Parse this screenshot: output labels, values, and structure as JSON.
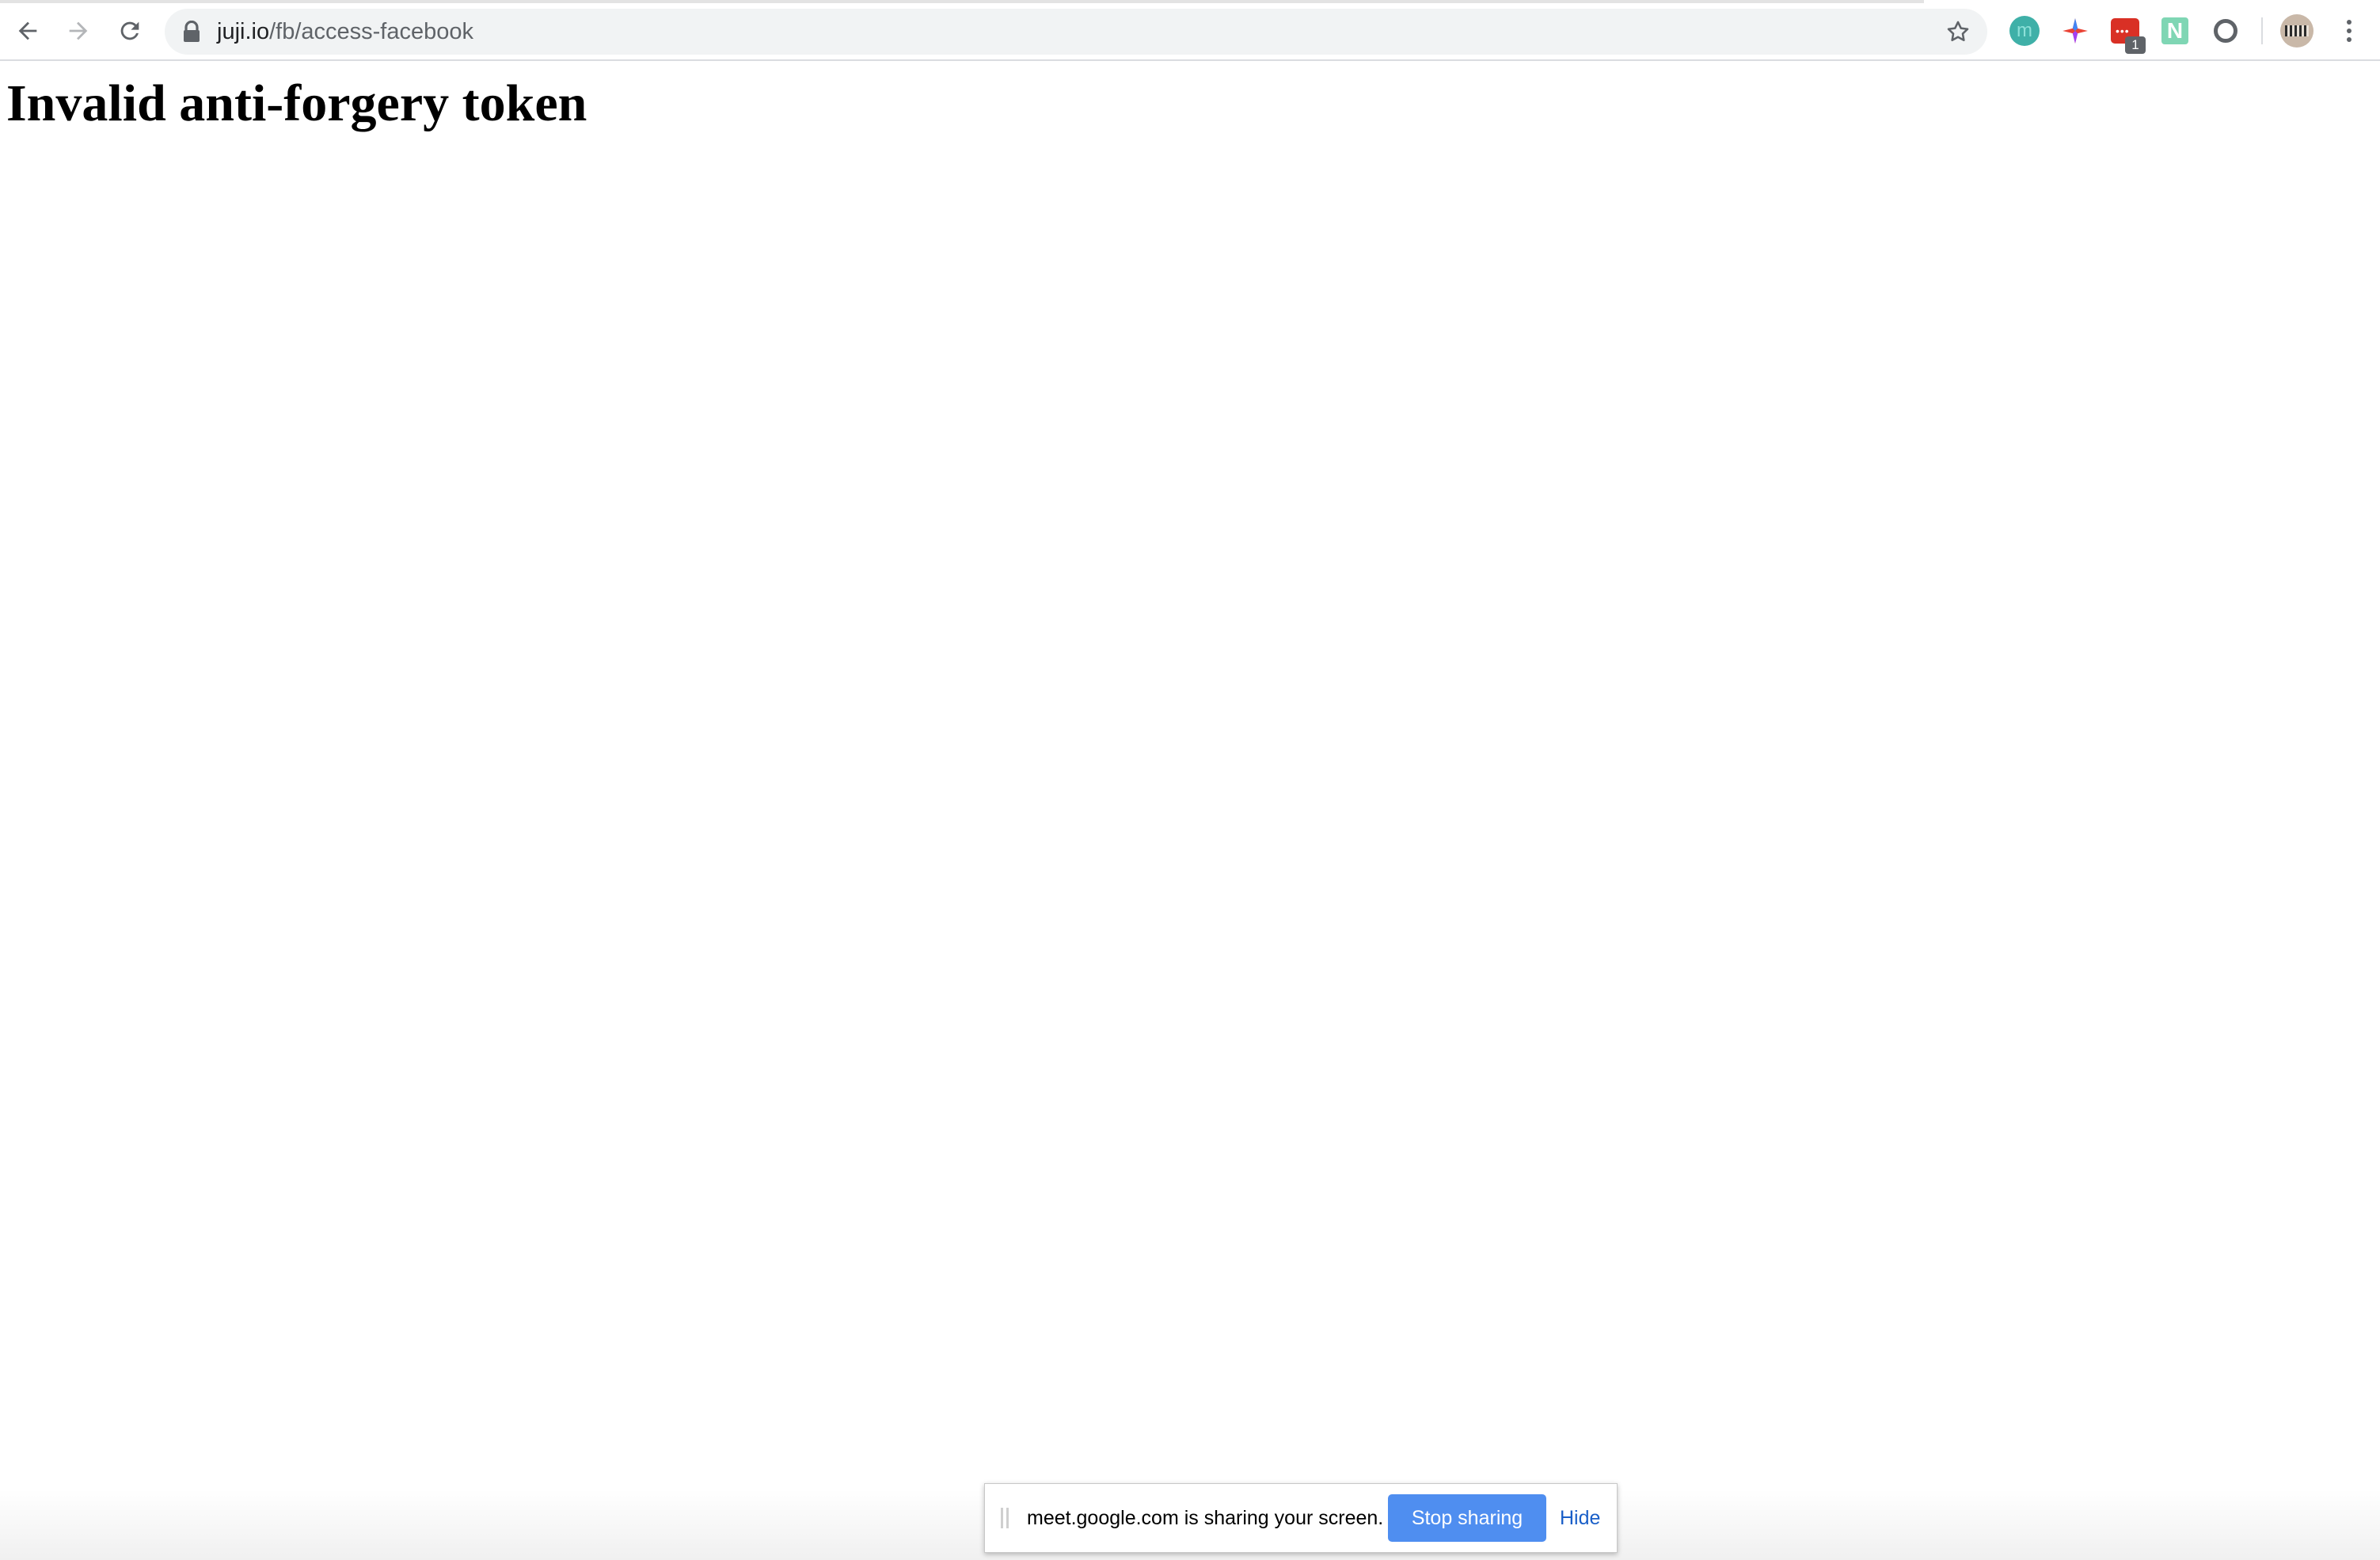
{
  "browser": {
    "url_host": "juji.io",
    "url_path": "/fb/access-facebook",
    "extensions": [
      {
        "name": "circle-extension-icon",
        "color": "#3fb0a8"
      },
      {
        "name": "sparkle-extension-icon",
        "color": "#ea4335"
      },
      {
        "name": "red-extension-icon",
        "color": "#d93025",
        "badge": "1"
      },
      {
        "name": "n-extension-icon",
        "label": "N",
        "color": "#7fd6b4"
      },
      {
        "name": "ring-extension-icon",
        "color": "#5f6368"
      }
    ]
  },
  "page": {
    "heading": "Invalid anti-forgery token"
  },
  "share_bar": {
    "message": "meet.google.com is sharing your screen.",
    "stop_label": "Stop sharing",
    "hide_label": "Hide",
    "accent_color": "#4f8ef0",
    "link_color": "#1a5fc8"
  }
}
